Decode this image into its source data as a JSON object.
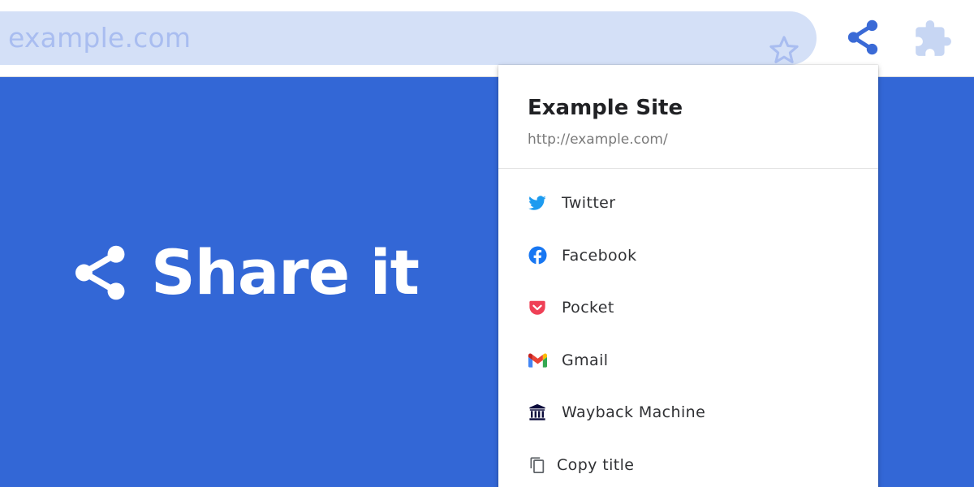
{
  "toolbar": {
    "url": "example.com",
    "bookmark_icon": "star-outline-icon",
    "share_icon": "share-icon",
    "extensions_icon": "puzzle-piece-icon"
  },
  "hero": {
    "icon": "share-icon",
    "title": "Share it"
  },
  "popup": {
    "title": "Example Site",
    "url": "http://example.com/",
    "items": [
      {
        "label": "Twitter",
        "icon": "twitter-icon",
        "color": "#1d9bf0"
      },
      {
        "label": "Facebook",
        "icon": "facebook-icon",
        "color": "#1877f2"
      },
      {
        "label": "Pocket",
        "icon": "pocket-icon",
        "color": "#ef4056"
      },
      {
        "label": "Gmail",
        "icon": "gmail-icon",
        "color": "#ea4335"
      },
      {
        "label": "Wayback Machine",
        "icon": "wayback-machine-icon",
        "color": "#0b0b3b"
      },
      {
        "label": "Copy title",
        "icon": "copy-icon",
        "color": "#5f6368"
      }
    ]
  },
  "colors": {
    "page_background": "#3367d6",
    "url_bar_background": "#d4e0f7",
    "url_text": "#a9bdf0",
    "toolbar_icon": "#3a6ad6",
    "extensions_icon": "#c7d6f3"
  }
}
